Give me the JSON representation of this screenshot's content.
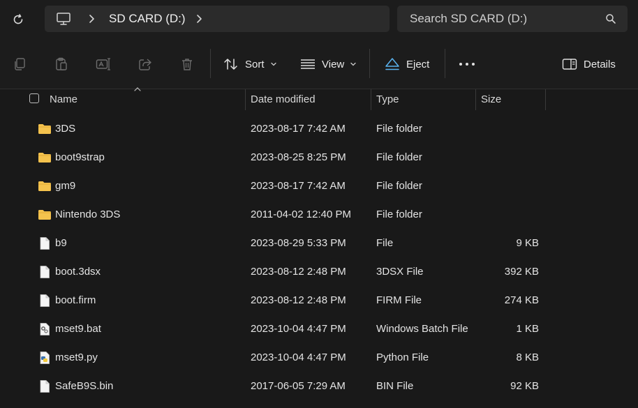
{
  "address": {
    "location": "SD CARD (D:)"
  },
  "search": {
    "placeholder": "Search SD CARD (D:)"
  },
  "toolbar": {
    "sort_label": "Sort",
    "view_label": "View",
    "eject_label": "Eject",
    "details_label": "Details"
  },
  "columns": {
    "name": "Name",
    "date": "Date modified",
    "type": "Type",
    "size": "Size"
  },
  "files": [
    {
      "name": "3DS",
      "date": "2023-08-17 7:42 AM",
      "type": "File folder",
      "size": "",
      "icon": "folder-icon"
    },
    {
      "name": "boot9strap",
      "date": "2023-08-25 8:25 PM",
      "type": "File folder",
      "size": "",
      "icon": "folder-icon"
    },
    {
      "name": "gm9",
      "date": "2023-08-17 7:42 AM",
      "type": "File folder",
      "size": "",
      "icon": "folder-icon"
    },
    {
      "name": "Nintendo 3DS",
      "date": "2011-04-02 12:40 PM",
      "type": "File folder",
      "size": "",
      "icon": "folder-icon"
    },
    {
      "name": "b9",
      "date": "2023-08-29 5:33 PM",
      "type": "File",
      "size": "9 KB",
      "icon": "file-icon"
    },
    {
      "name": "boot.3dsx",
      "date": "2023-08-12 2:48 PM",
      "type": "3DSX File",
      "size": "392 KB",
      "icon": "file-icon"
    },
    {
      "name": "boot.firm",
      "date": "2023-08-12 2:48 PM",
      "type": "FIRM File",
      "size": "274 KB",
      "icon": "file-icon"
    },
    {
      "name": "mset9.bat",
      "date": "2023-10-04 4:47 PM",
      "type": "Windows Batch File",
      "size": "1 KB",
      "icon": "batch-file-icon"
    },
    {
      "name": "mset9.py",
      "date": "2023-10-04 4:47 PM",
      "type": "Python File",
      "size": "8 KB",
      "icon": "python-file-icon"
    },
    {
      "name": "SafeB9S.bin",
      "date": "2017-06-05 7:29 AM",
      "type": "BIN File",
      "size": "92 KB",
      "icon": "file-icon"
    }
  ],
  "colors": {
    "background": "#191919",
    "bar": "#2b2b2b",
    "folder": "#f4c24d",
    "eject_accent": "#5ab4f0"
  }
}
